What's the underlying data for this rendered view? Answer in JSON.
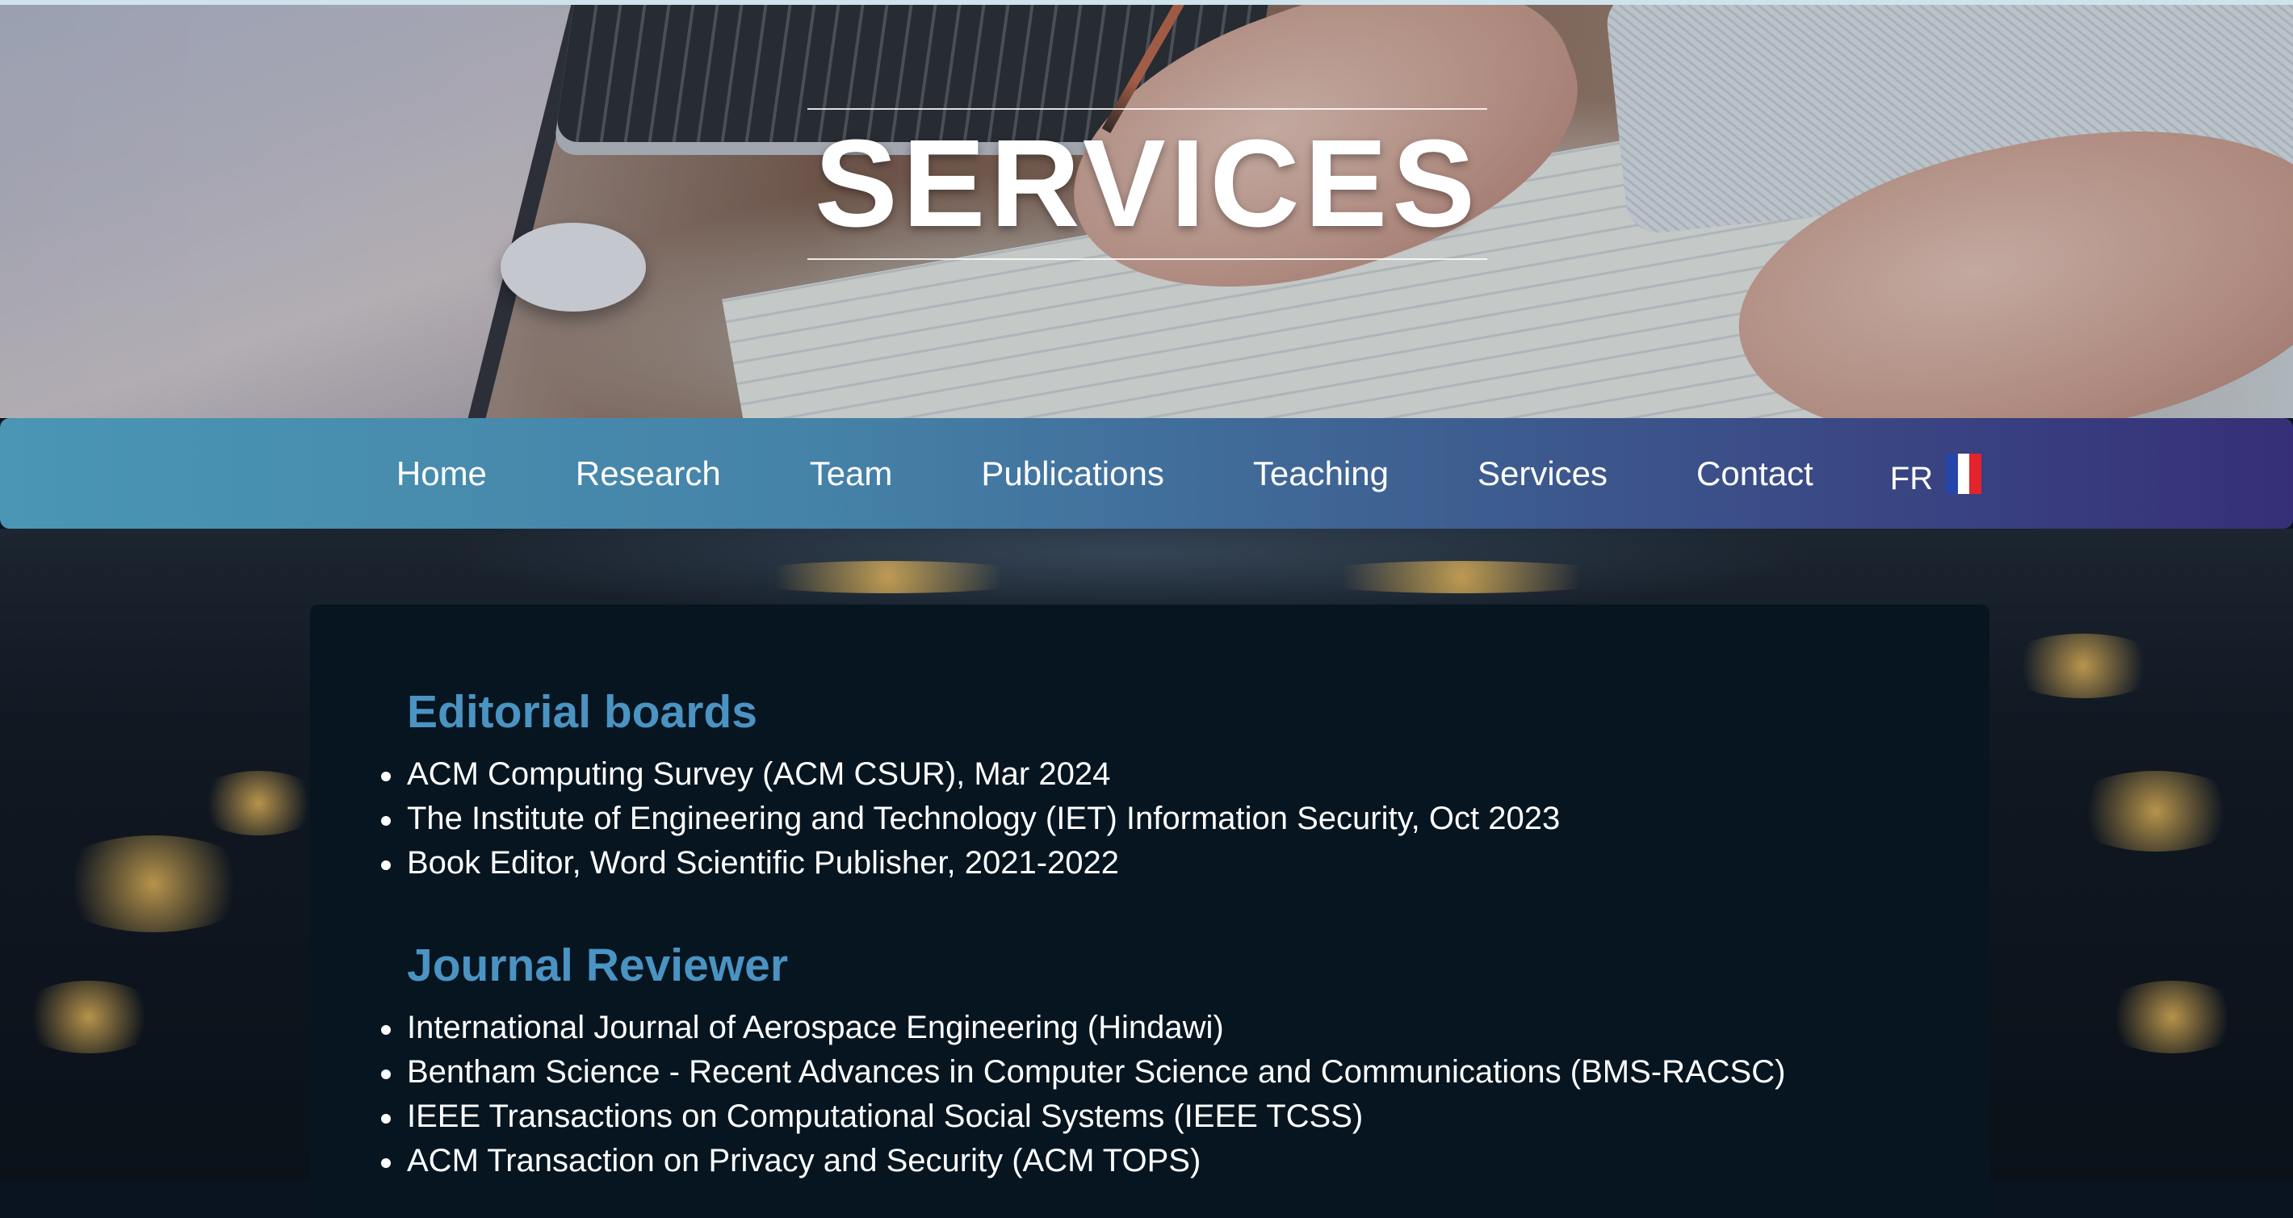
{
  "hero": {
    "title": "SERVICES"
  },
  "nav": {
    "items": [
      {
        "label": "Home"
      },
      {
        "label": "Research"
      },
      {
        "label": "Team"
      },
      {
        "label": "Publications"
      },
      {
        "label": "Teaching"
      },
      {
        "label": "Services"
      },
      {
        "label": "Contact"
      }
    ],
    "language": {
      "label": "FR",
      "icon": "french-flag-icon"
    },
    "colors": {
      "gradient_start": "#4a96b4",
      "gradient_end": "#362f78"
    }
  },
  "sections": [
    {
      "title": "Editorial boards",
      "items": [
        "ACM Computing Survey (ACM CSUR), Mar 2024",
        "The Institute of Engineering and Technology (IET) Information Security, Oct 2023",
        "Book Editor, Word Scientific Publisher, 2021-2022"
      ]
    },
    {
      "title": "Journal Reviewer",
      "items": [
        "International Journal of Aerospace Engineering (Hindawi)",
        "Bentham Science - Recent Advances in Computer Science and Communications (BMS-RACSC)",
        "IEEE Transactions on Computational Social Systems (IEEE TCSS)",
        "ACM Transaction on Privacy and Security (ACM TOPS)"
      ]
    }
  ],
  "colors": {
    "section_title": "#4a93c2",
    "card_background": "#061520"
  }
}
